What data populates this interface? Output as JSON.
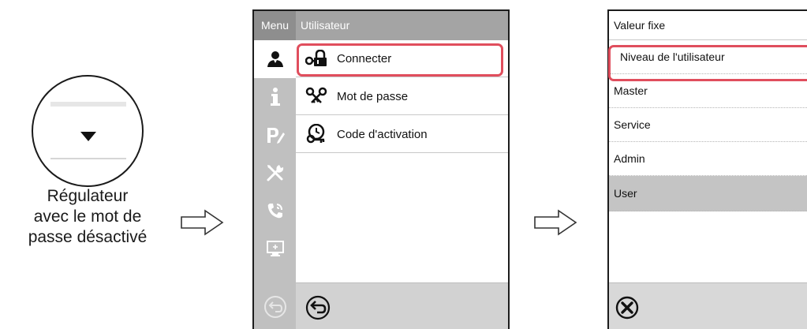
{
  "caption": {
    "line1": "Régulateur",
    "line2": "avec le mot de",
    "line3": "passe désactivé"
  },
  "menu_screen": {
    "sidebar_title": "Menu",
    "header_title": "Utilisateur",
    "sidebar_icons": [
      "user-icon",
      "info-icon",
      "program-icon",
      "settings-tools-icon",
      "service-phone-icon",
      "display-icon",
      "exit-icon"
    ],
    "items": [
      {
        "label": "Connecter",
        "icon": "login-lock-icon",
        "highlighted": true
      },
      {
        "label": "Mot de passe",
        "icon": "password-keys-icon"
      },
      {
        "label": "Code d'activation",
        "icon": "activation-code-icon"
      }
    ],
    "footer_icon": "back-icon"
  },
  "user_level_screen": {
    "header_title": "Valeur fixe",
    "field_label": "Niveau de l'utilisateur",
    "options": [
      "Master",
      "Service",
      "Admin",
      "User"
    ],
    "selected_option": "User",
    "footer_icon": "cancel-icon"
  },
  "colors": {
    "highlight": "#e04e5d",
    "sidebar": "#c0c0c0",
    "header": "#a4a4a4",
    "selected_row": "#c4c4c4",
    "footer": "#d2d2d2"
  }
}
